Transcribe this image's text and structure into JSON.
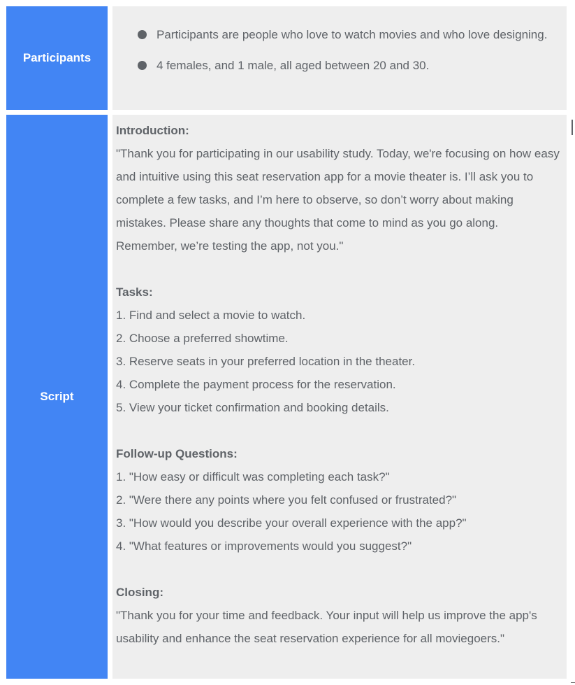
{
  "participants": {
    "label": "Participants",
    "items": [
      "Participants are people who love to watch movies and who love designing.",
      "4 females, and 1 male, all aged between 20 and 30."
    ]
  },
  "script": {
    "label": "Script",
    "introduction": {
      "heading": "Introduction:",
      "text": "\"Thank you for participating in our usability study. Today, we're focusing on how easy and intuitive using this seat reservation app for a movie theater is. I’ll ask you to complete a few tasks, and I’m here to observe, so don’t worry about making mistakes. Please share any thoughts that come to mind as you go along. Remember, we’re testing the app, not you.\""
    },
    "tasks": {
      "heading": "Tasks:",
      "items": [
        "1. Find and select a movie to watch.",
        "2. Choose a preferred showtime.",
        "3. Reserve seats in your preferred location in the theater.",
        "4. Complete the payment process for the reservation.",
        "5. View your ticket confirmation and booking details."
      ]
    },
    "followup": {
      "heading": "Follow-up Questions:",
      "items": [
        "1. \"How easy or difficult was completing each task?\"",
        "2. \"Were there any points where you felt confused or frustrated?\"",
        "3. \"How would you describe your overall experience with the app?\"",
        "4. \"What features or improvements would you suggest?\""
      ]
    },
    "closing": {
      "heading": "Closing:",
      "text": "\"Thank you for your time and feedback. Your input will help us improve the app's usability and enhance the seat reservation experience for all moviegoers.\""
    }
  }
}
